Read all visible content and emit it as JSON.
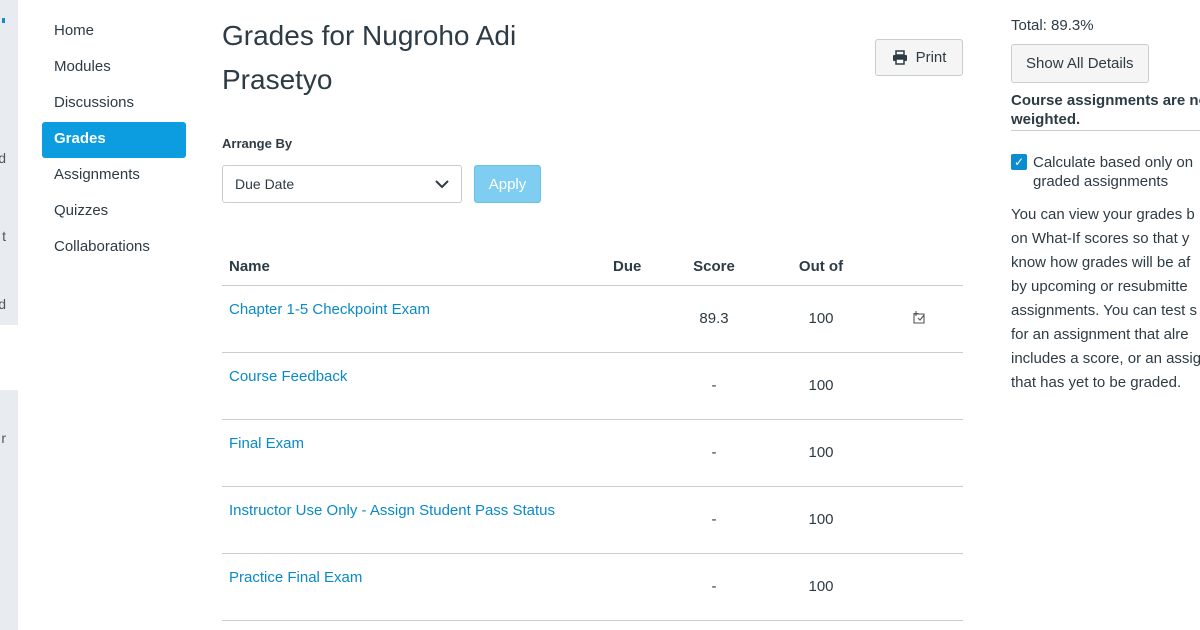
{
  "global_nav": {
    "fragments": [
      "d",
      "t",
      "rd",
      "r"
    ]
  },
  "course_nav": {
    "items": [
      {
        "label": "Home"
      },
      {
        "label": "Modules"
      },
      {
        "label": "Discussions"
      },
      {
        "label": "Grades",
        "active": true
      },
      {
        "label": "Assignments"
      },
      {
        "label": "Quizzes"
      },
      {
        "label": "Collaborations"
      }
    ]
  },
  "header": {
    "title": "Grades for Nugroho Adi Prasetyo",
    "print_label": "Print",
    "print_icon": "printer-icon"
  },
  "arrange": {
    "label": "Arrange By",
    "selected": "Due Date",
    "apply_label": "Apply"
  },
  "table": {
    "columns": [
      "Name",
      "Due",
      "Score",
      "Out of"
    ],
    "rows": [
      {
        "name": "Chapter 1-5 Checkpoint Exam",
        "due": "",
        "score": "89.3",
        "out_of": "100",
        "icon": "what-if-icon"
      },
      {
        "name": "Course Feedback",
        "due": "",
        "score": "-",
        "out_of": "100"
      },
      {
        "name": "Final Exam",
        "due": "",
        "score": "-",
        "out_of": "100"
      },
      {
        "name": "Instructor Use Only - Assign Student Pass Status",
        "due": "",
        "score": "-",
        "out_of": "100"
      },
      {
        "name": "Practice Final Exam",
        "due": "",
        "score": "-",
        "out_of": "100"
      }
    ]
  },
  "sidebar": {
    "total": "Total: 89.3%",
    "show_details": "Show All Details",
    "weight_note_1": "Course assignments are no",
    "weight_note_2": "weighted.",
    "checkbox_1": "Calculate based only on",
    "checkbox_2": "graded assignments",
    "checkbox_checked": true,
    "info_lines": [
      "You can view your grades b",
      "on What-If scores so that y",
      "know how grades will be af",
      "by upcoming or resubmitte",
      "assignments. You can test s",
      "for an assignment that alre",
      "includes a score, or an assig",
      "that has yet to be graded."
    ]
  },
  "colors": {
    "accent": "#0b9de0",
    "link": "#0a8ac7",
    "apply_disabled": "#7fcdf0"
  }
}
